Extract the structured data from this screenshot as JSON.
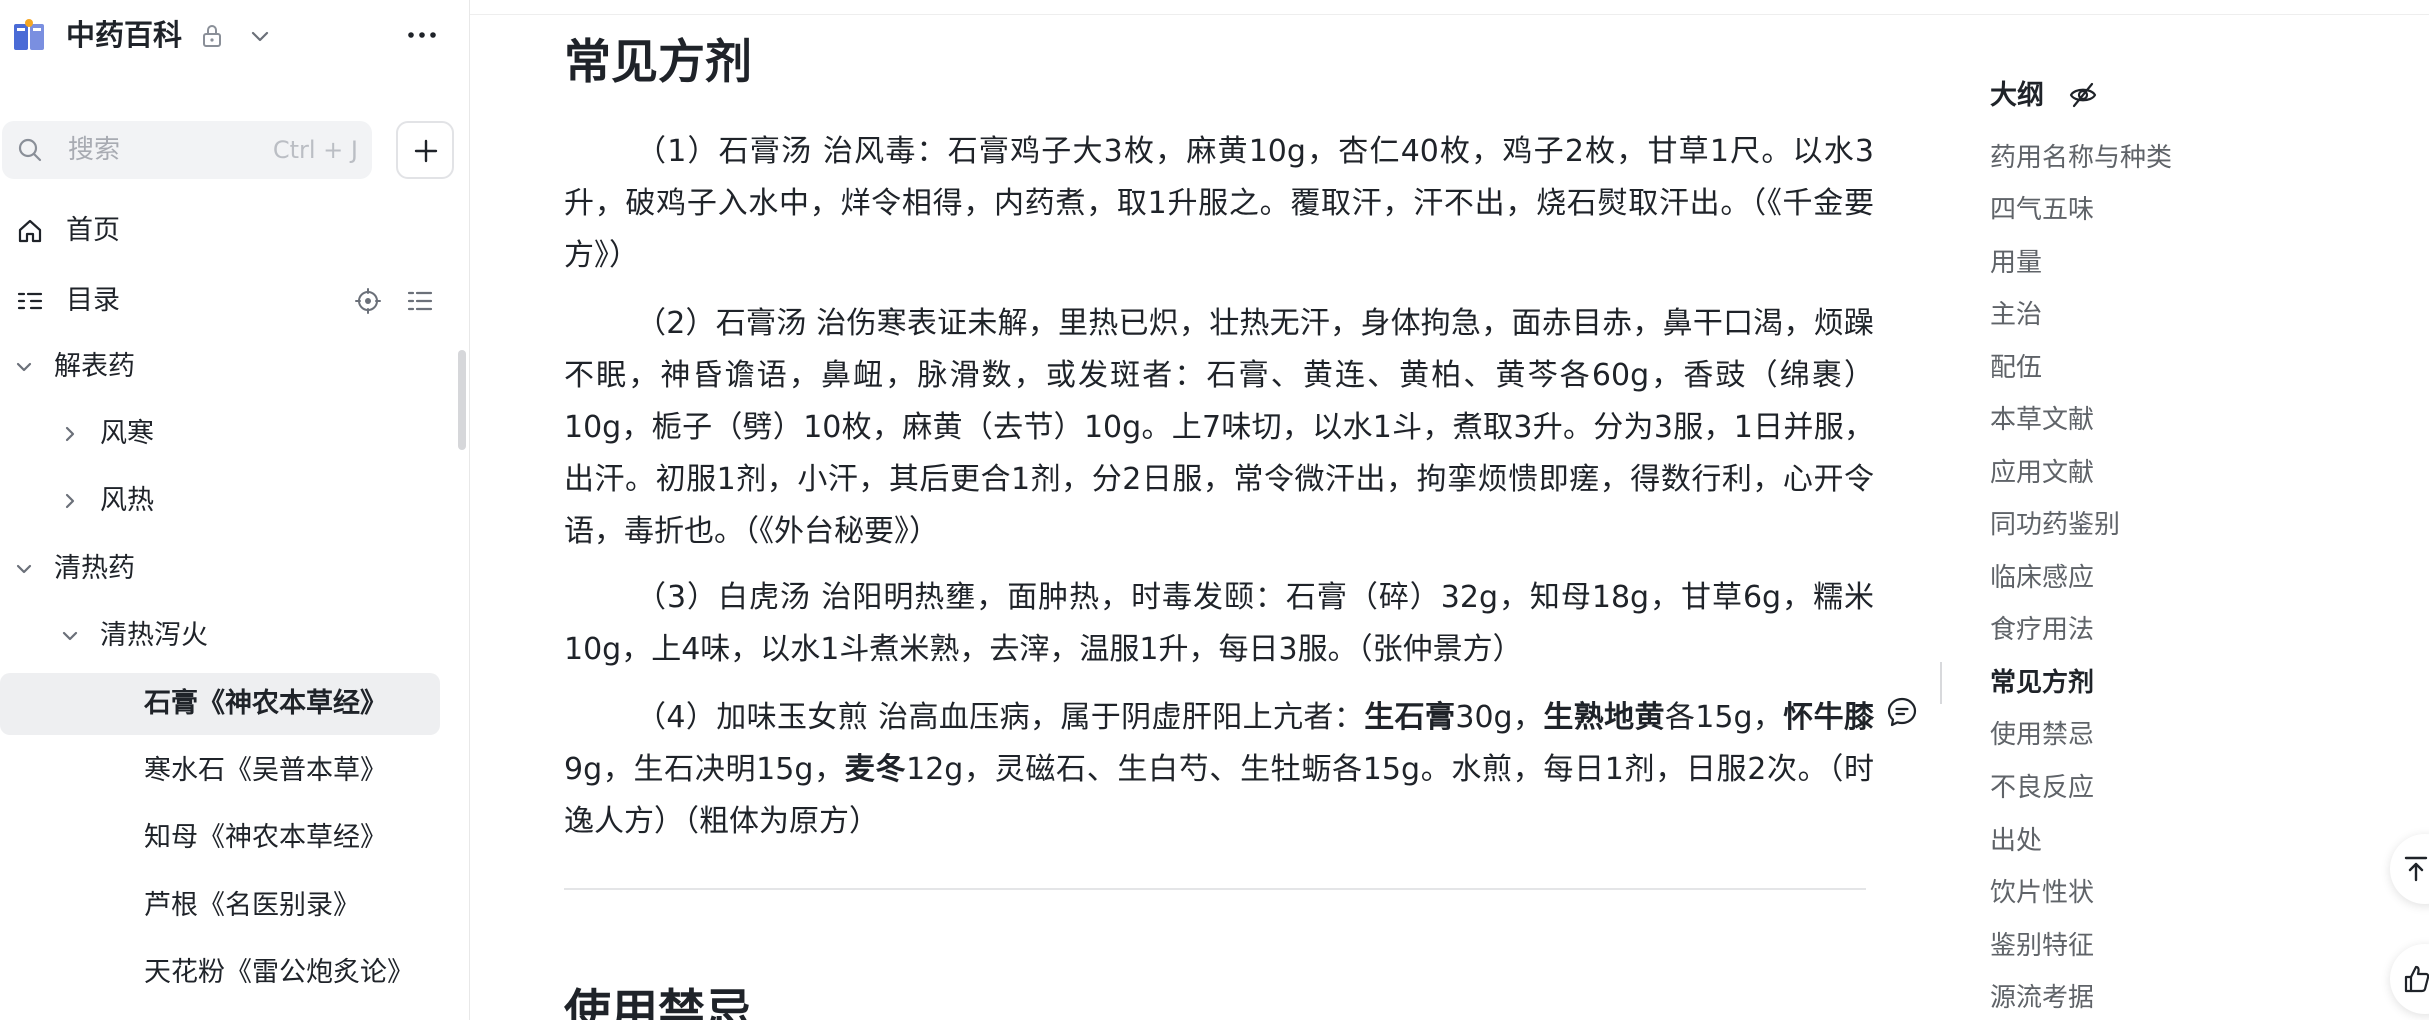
{
  "sidebar": {
    "title": "中药百科",
    "search": {
      "placeholder": "搜索",
      "shortcut": "Ctrl + J"
    },
    "nav": [
      {
        "label": "首页",
        "icon": "home-icon"
      },
      {
        "label": "目录",
        "icon": "toc-icon"
      }
    ],
    "tree": [
      {
        "label": "解表药",
        "level": 0,
        "expanded": true
      },
      {
        "label": "风寒",
        "level": 1,
        "expanded": false
      },
      {
        "label": "风热",
        "level": 1,
        "expanded": false
      },
      {
        "label": "清热药",
        "level": 0,
        "expanded": true
      },
      {
        "label": "清热泻火",
        "level": 1,
        "expanded": true
      },
      {
        "label": "石膏《神农本草经》",
        "level": 2,
        "active": true
      },
      {
        "label": "寒水石《吴普本草》",
        "level": 2
      },
      {
        "label": "知母《神农本草经》",
        "level": 2
      },
      {
        "label": "芦根《名医别录》",
        "level": 2
      },
      {
        "label": "天花粉《雷公炮炙论》",
        "level": 2
      }
    ]
  },
  "content": {
    "heading": "常见方剂",
    "paragraphs": [
      {
        "text": "（1）石膏汤 治风毒：石膏鸡子大3枚，麻黄10g，杏仁40枚，鸡子2枚，甘草1尺。以水3升，破鸡子入水中，烊令相得，内药煮，取1升服之。覆取汗，汗不出，烧石熨取汗出。（《千金要方》）"
      },
      {
        "text": "（2）石膏汤 治伤寒表证未解，里热已炽，壮热无汗，身体拘急，面赤目赤，鼻干口渴，烦躁不眠，神昏谵语，鼻衄，脉滑数，或发斑者：石膏、黄连、黄柏、黄芩各60g，香豉（绵裹）10g，栀子（劈）10枚，麻黄（去节）10g。上7味切，以水1斗，煮取3升。分为3服，1日并服，出汗。初服1剂，小汗，其后更合1剂，分2日服，常令微汗出，拘挛烦愦即瘥，得数行利，心开令语，毒折也。（《外台秘要》）"
      },
      {
        "text": "（3）白虎汤 治阳明热壅，面肿热，时毒发颐：石膏（碎）32g，知母18g，甘草6g，糯米10g，上4味，以水1斗煮米熟，去滓，温服1升，每日3服。（张仲景方）"
      },
      {
        "p1": "（4）加味玉女煎 治高血压病，属于阴虚肝阳上亢者：",
        "b1": "生石膏",
        "p2": "30g，",
        "b2": "生熟地黄",
        "p3": "各15g，",
        "b3": "怀牛膝",
        "p4": "9g，生石决明15g，",
        "b4": "麦冬",
        "p5": "12g，灵磁石、生白芍、生牡蛎各15g。水煎，每日1剂，日服2次。（时逸人方）（粗体为原方）"
      }
    ],
    "next_heading": "使用禁忌"
  },
  "outline": {
    "title": "大纲",
    "items": [
      "药用名称与种类",
      "四气五味",
      "用量",
      "主治",
      "配伍",
      "本草文献",
      "应用文献",
      "同功药鉴别",
      "临床感应",
      "食疗用法",
      "常见方剂",
      "使用禁忌",
      "不良反应",
      "出处",
      "饮片性状",
      "鉴别特征",
      "源流考据"
    ],
    "active_index": 10
  }
}
